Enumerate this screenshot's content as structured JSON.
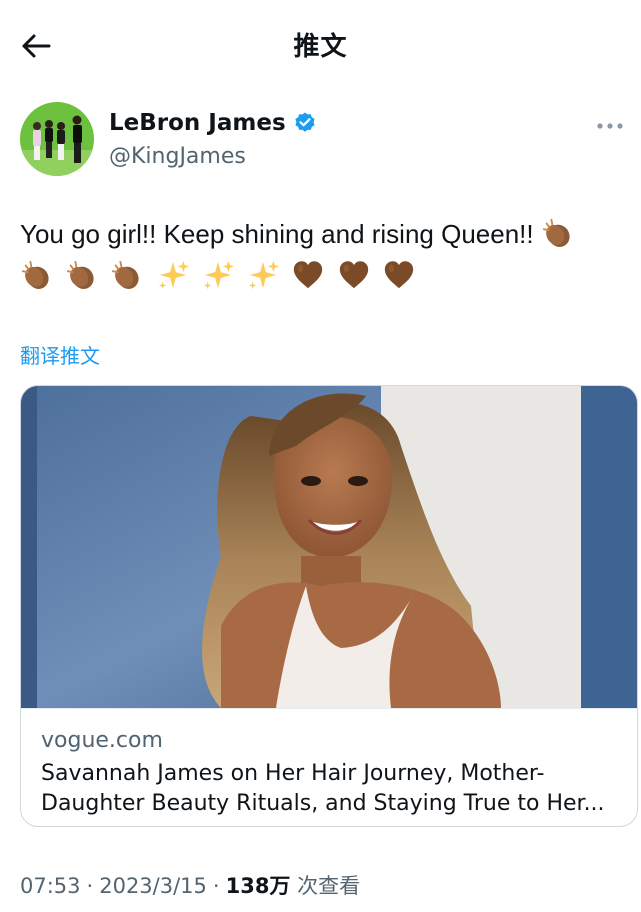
{
  "header": {
    "title": "推文",
    "back_icon": "arrow-left-icon"
  },
  "author": {
    "name": "LeBron James",
    "handle": "@KingJames",
    "verified": true,
    "verified_color": "#1d9bf0",
    "avatar_bg": "#66c23a"
  },
  "tweet": {
    "text": "You go girl!! Keep shining and rising Queen!!",
    "emoji_line1": [
      "clapping-hands-icon"
    ],
    "emoji_line2": [
      "clapping-hands-icon",
      "clapping-hands-icon",
      "clapping-hands-icon",
      "sparkles-icon",
      "sparkles-icon",
      "sparkles-icon",
      "brown-heart-icon",
      "brown-heart-icon",
      "brown-heart-icon"
    ]
  },
  "translate_label": "翻译推文",
  "link_card": {
    "domain": "vogue.com",
    "title": "Savannah James on Her Hair Journey, Mother-Daughter Beauty Rituals, and Staying True to Her..."
  },
  "meta": {
    "time": "07:53",
    "date": "2023/3/15",
    "views_count": "138万",
    "views_label": "次查看"
  },
  "colors": {
    "accent": "#1d9bf0",
    "text": "#0f1419",
    "muted": "#536471",
    "border": "#cfd9de"
  }
}
